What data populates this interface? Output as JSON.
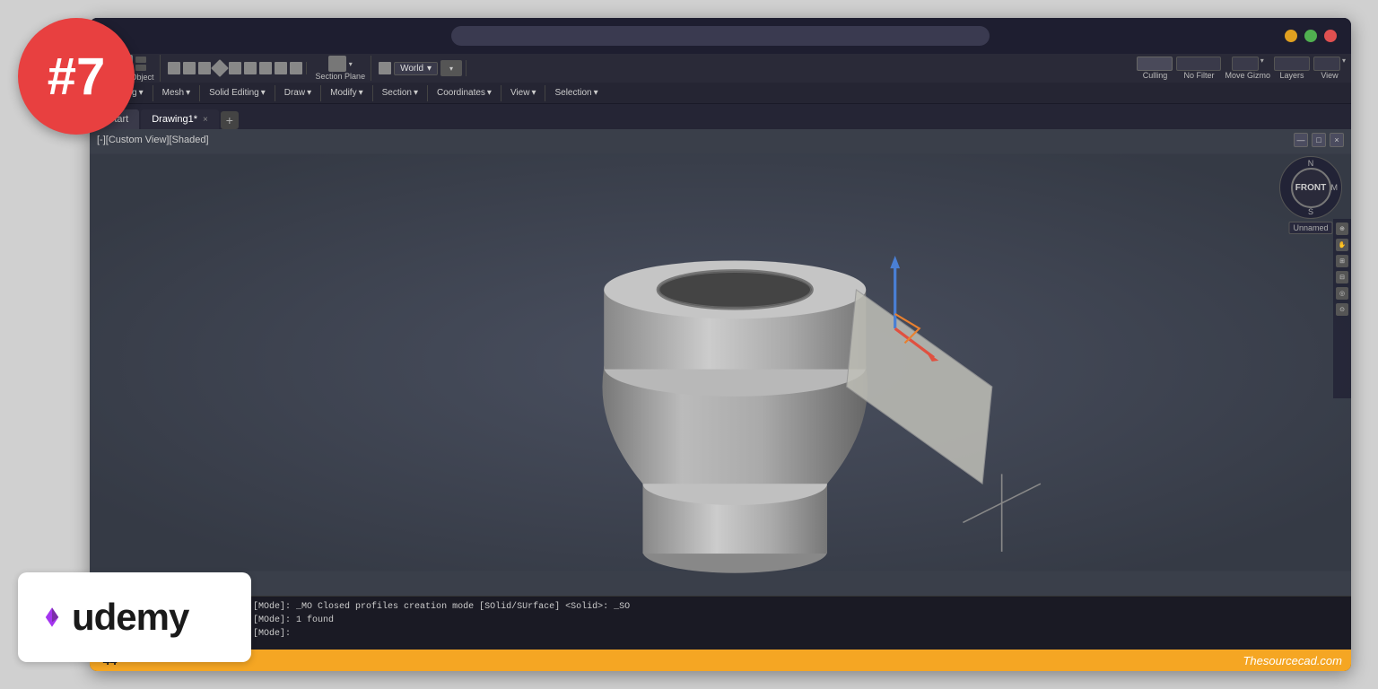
{
  "badge": {
    "number": "#7"
  },
  "titlebar": {
    "close_btn": "●",
    "min_btn": "●",
    "max_btn": "●"
  },
  "toolbar": {
    "smooth_object": "Smooth Object",
    "solid_editing": "Solid Editing",
    "section_plane": "Section Plane",
    "section": "Section",
    "world": "World",
    "modeling": "Modeling",
    "mesh": "Mesh",
    "draw": "Draw",
    "modify": "Modify",
    "coordinates": "Coordinates",
    "view_menu": "View",
    "culling": "Culling",
    "no_filter": "No Filter",
    "move_gizmo": "Move Gizmo",
    "layers": "Layers",
    "view_right": "View",
    "selection": "Selection",
    "dropdown_arrow": "▾"
  },
  "tabs": {
    "start": "Start",
    "drawing": "Drawing1*",
    "add": "+"
  },
  "viewport": {
    "label": "[-][Custom View][Shaded]",
    "ctrl_minimize": "—",
    "ctrl_restore": "□",
    "ctrl_close": "×"
  },
  "compass": {
    "n": "N",
    "s": "S",
    "m": "M",
    "front": "FRONT",
    "unnamed": "Unnamed"
  },
  "command_line": {
    "line1": "Select objects to extrude or [MOde]: _MO Closed profiles creation mode [SOlid/SUrface] <Solid>: _SO",
    "line2": "Select objects to extrude or [MOde]: 1 found",
    "line3": "Select objects to extrude or [MOde]:"
  },
  "status_bar": {
    "number": "-44",
    "watermark": "Thesourcecad.com"
  },
  "udemy": {
    "text": "udemy"
  }
}
